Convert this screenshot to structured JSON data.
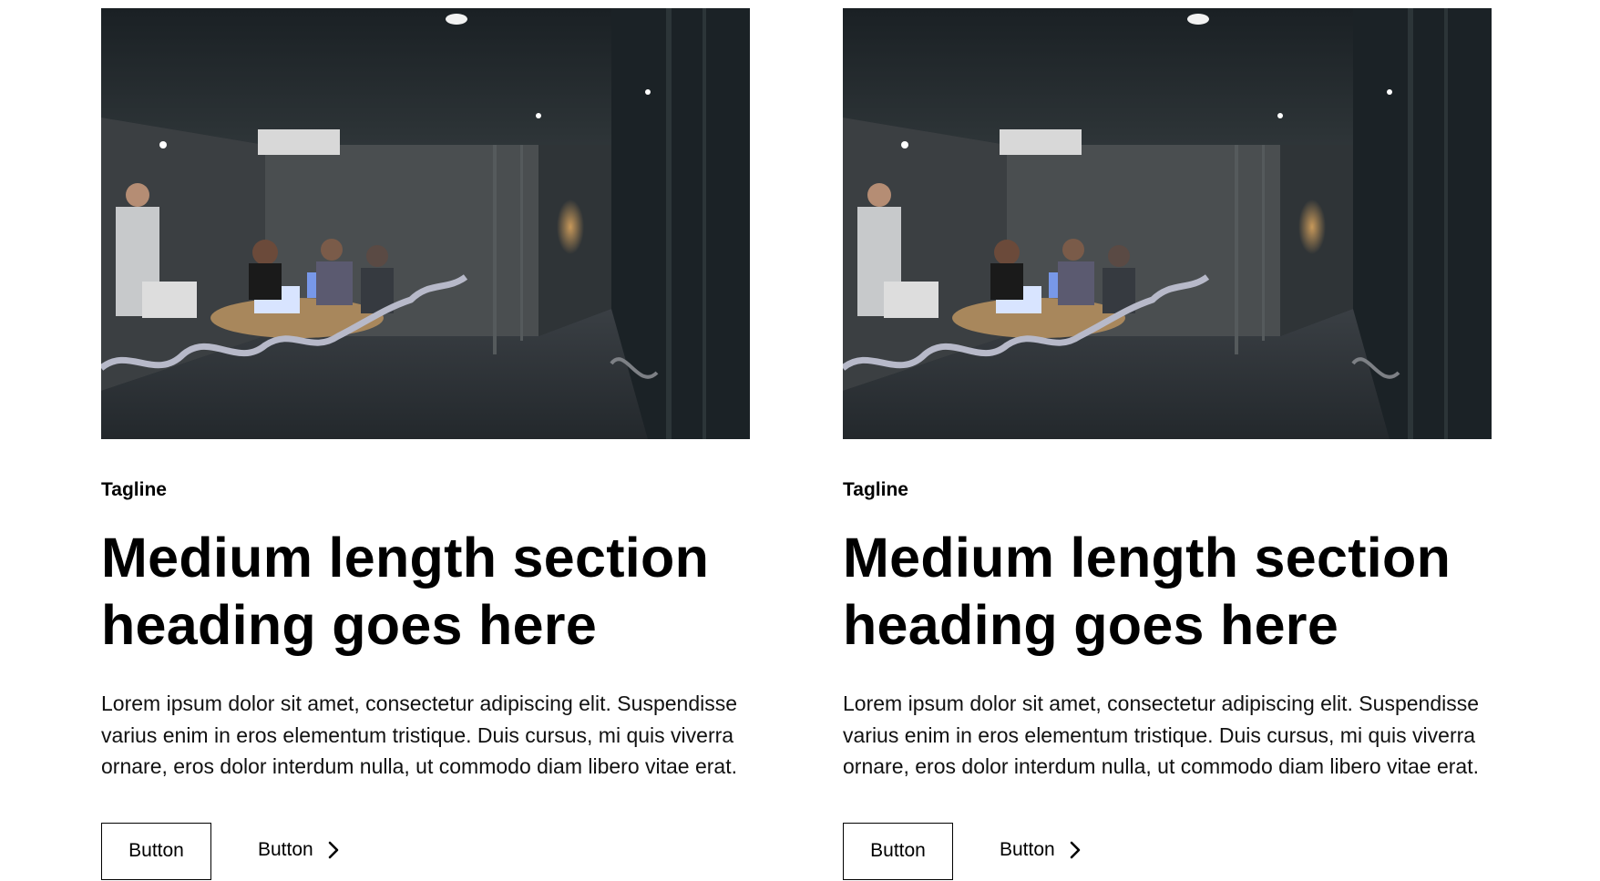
{
  "cards": [
    {
      "image": {
        "subject": "meeting room at night",
        "icon": "photo"
      },
      "tagline": "Tagline",
      "heading": "Medium length section heading goes here",
      "body": "Lorem ipsum dolor sit amet, consectetur adipiscing elit. Suspendisse varius enim in eros elementum tristique. Duis cursus, mi quis viverra ornare, eros dolor interdum nulla, ut commodo diam libero vitae erat.",
      "primary_button": "Button",
      "link_button": "Button",
      "link_icon": "chevron-right-icon"
    },
    {
      "image": {
        "subject": "meeting room at night",
        "icon": "photo"
      },
      "tagline": "Tagline",
      "heading": "Medium length section heading goes here",
      "body": "Lorem ipsum dolor sit amet, consectetur adipiscing elit. Suspendisse varius enim in eros elementum tristique. Duis cursus, mi quis viverra ornare, eros dolor interdum nulla, ut commodo diam libero vitae erat.",
      "primary_button": "Button",
      "link_button": "Button",
      "link_icon": "chevron-right-icon"
    }
  ],
  "colors": {
    "text": "#000000",
    "background": "#ffffff",
    "photo_dark": "#1c2328"
  }
}
